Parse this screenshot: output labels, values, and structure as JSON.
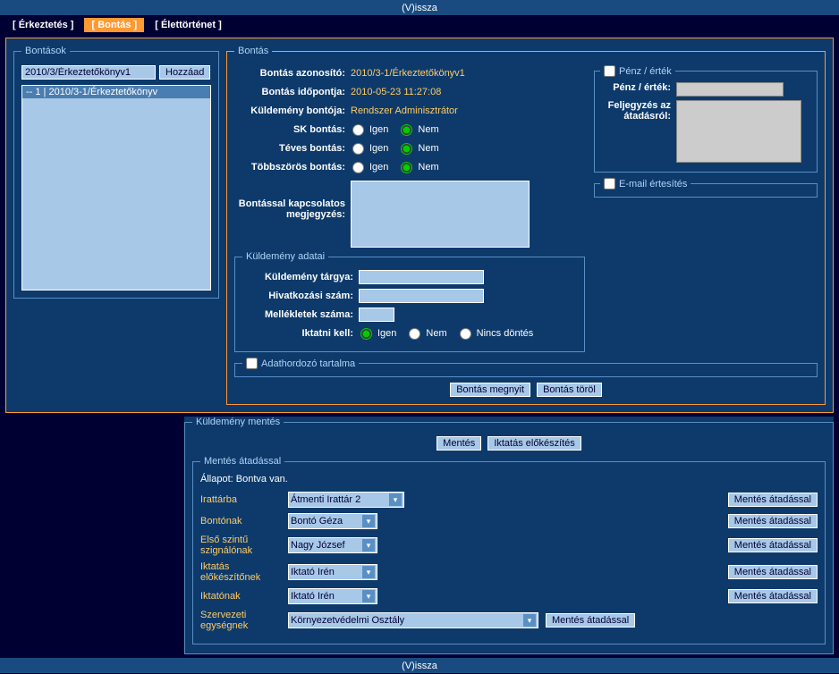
{
  "back_label": "(V)issza",
  "tabs": {
    "erkeztetes": "[ Érkeztetés ]",
    "bontas": "[ Bontás ]",
    "elettortenet": "[ Élettörténet ]"
  },
  "bontasok": {
    "legend": "Bontások",
    "input_value": "2010/3/Érkeztetőkönyv1",
    "add_btn": "Hozzáad",
    "list_item": "-- 1 | 2010/3-1/Érkeztetőkönyv"
  },
  "bontas": {
    "legend": "Bontás",
    "azonosito_lbl": "Bontás azonosító:",
    "azonosito_val": "2010/3-1/Érkeztetőkönyv1",
    "idopont_lbl": "Bontás időpontja:",
    "idopont_val": "2010-05-23 11:27:08",
    "bonto_lbl": "Küldemény bontója:",
    "bonto_val": "Rendszer Adminisztrátor",
    "sk_lbl": "SK bontás:",
    "teves_lbl": "Téves bontás:",
    "tobbsz_lbl": "Többszörös bontás:",
    "igen": "Igen",
    "nem": "Nem",
    "megj_lbl": "Bontással kapcsolatos megjegyzés:",
    "penz_legend": "Pénz / érték",
    "penz_lbl": "Pénz / érték:",
    "felj_lbl": "Feljegyzés az átadásról:",
    "email_legend": "E-mail értesítés",
    "open_btn": "Bontás megnyit",
    "del_btn": "Bontás töröl"
  },
  "kuld": {
    "legend": "Küldemény adatai",
    "targy_lbl": "Küldemény tárgya:",
    "hivsz_lbl": "Hivatkozási szám:",
    "mell_lbl": "Mellékletek száma:",
    "ikt_lbl": "Iktatni kell:",
    "nincs": "Nincs döntés"
  },
  "adat_legend": "Adathordozó tartalma",
  "mentes": {
    "legend": "Küldemény mentés",
    "mentes_btn": "Mentés",
    "iktatas_btn": "Iktatás előkészítés",
    "atad_legend": "Mentés átadással",
    "allapot_lbl": "Állapot:",
    "allapot_val": "Bontva van.",
    "irattarba": "Irattárba",
    "irattarba_val": "Átmenti Irattár 2",
    "bontonak": "Bontónak",
    "bontonak_val": "Bontó Géza",
    "szignalo": "Első szintű szignálónak",
    "szignalo_val": "Nagy József",
    "iktelok": "Iktatás előkészítőnek",
    "iktelok_val": "Iktató Irén",
    "iktatonak": "Iktatónak",
    "iktatonak_val": "Iktató Irén",
    "szerv": "Szervezeti egységnek",
    "szerv_val": "Környezetvédelmi Osztály",
    "atad_btn": "Mentés átadással"
  }
}
